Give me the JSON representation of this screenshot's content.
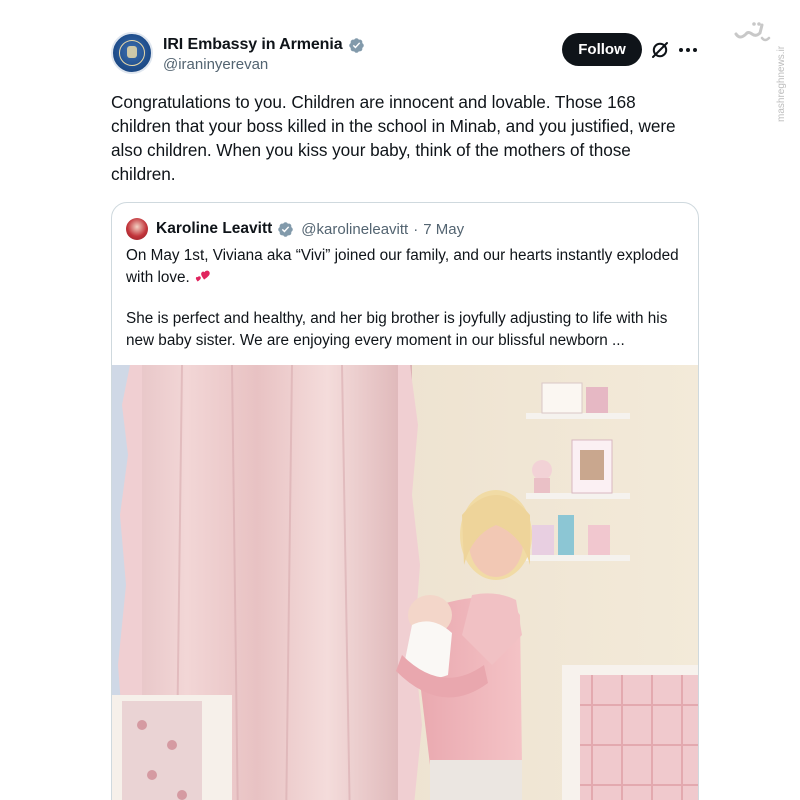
{
  "author": {
    "display_name": "IRI Embassy in Armenia",
    "handle": "@iraninyerevan",
    "verified": true,
    "avatar_icon": "embassy-seal-avatar"
  },
  "actions": {
    "follow_label": "Follow",
    "grok_icon": "grok-icon",
    "more_icon": "more-options-icon"
  },
  "post": {
    "text": "Congratulations to you. Children are innocent and lovable. Those 168 children that your boss killed in the school in Minab, and you justified, were also children. When you kiss your baby, think of the mothers of those children."
  },
  "quoted": {
    "display_name": "Karoline Leavitt",
    "handle": "@karolineleavitt",
    "separator": "·",
    "date": "7 May",
    "verified": true,
    "paragraph1": "On May 1st, Viviana aka “Vivi” joined our family, and our hearts instantly exploded with love.",
    "heart_emoji": "two-hearts-emoji",
    "paragraph2": "She is perfect and healthy, and her big brother is joyfully adjusting to life with his new baby sister. We are enjoying every moment in our blissful newborn ...",
    "media": "nursery-photo"
  },
  "watermark": {
    "logo": "مشرق",
    "url": "mashreghnews.ir"
  },
  "colors": {
    "text": "#0f1419",
    "secondary": "#536471",
    "verified": "#829aab",
    "border": "#cfd9de",
    "button": "#0f1419"
  }
}
